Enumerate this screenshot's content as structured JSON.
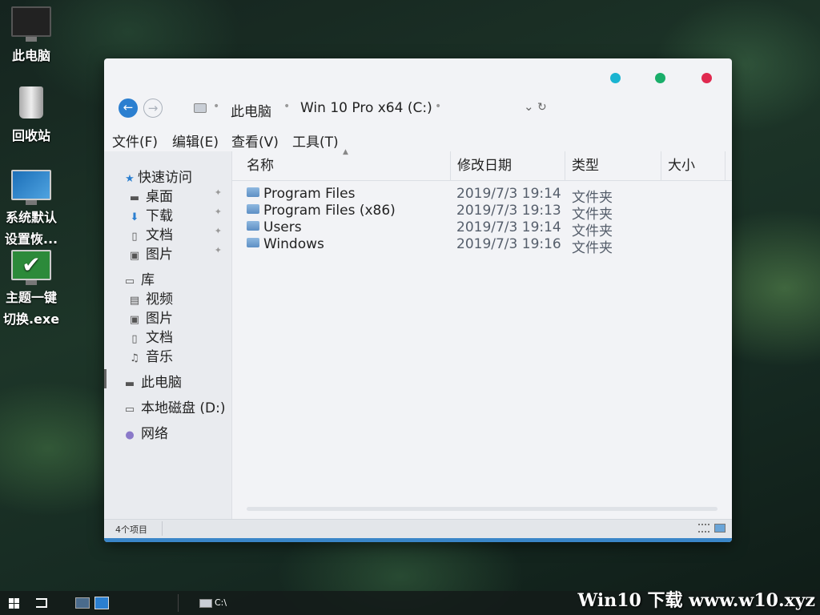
{
  "desktop": {
    "icons": [
      {
        "label": "此电脑"
      },
      {
        "label": "回收站"
      },
      {
        "label": "系统默认设置恢..."
      },
      {
        "label": "主题一键切换.exe"
      }
    ]
  },
  "window": {
    "controls_colors": [
      "#1ab4d1",
      "#1aae6a",
      "#e0294f"
    ],
    "address": {
      "back_label": "←",
      "forward_label": "→",
      "crumbs": [
        "此电脑",
        "Win 10 Pro x64 (C:)"
      ],
      "dropdown_label": "⌄",
      "refresh_label": "↻"
    },
    "menu": [
      "文件(F)",
      "编辑(E)",
      "查看(V)",
      "工具(T)"
    ],
    "sidebar": {
      "quick_access": "快速访问",
      "quick_items": [
        {
          "label": "桌面",
          "icon": "desktop-icon"
        },
        {
          "label": "下载",
          "icon": "download-icon"
        },
        {
          "label": "文档",
          "icon": "document-icon"
        },
        {
          "label": "图片",
          "icon": "picture-icon"
        }
      ],
      "library": "库",
      "library_items": [
        {
          "label": "视频",
          "icon": "video-icon"
        },
        {
          "label": "图片",
          "icon": "picture-icon"
        },
        {
          "label": "文档",
          "icon": "document-icon"
        },
        {
          "label": "音乐",
          "icon": "music-icon"
        }
      ],
      "this_pc": "此电脑",
      "local_disk": "本地磁盘 (D:)",
      "network": "网络"
    },
    "columns": [
      "名称",
      "修改日期",
      "类型",
      "大小"
    ],
    "files": [
      {
        "name": "Program Files",
        "date": "2019/7/3 19:14",
        "type": "文件夹"
      },
      {
        "name": "Program Files (x86)",
        "date": "2019/7/3 19:13",
        "type": "文件夹"
      },
      {
        "name": "Users",
        "date": "2019/7/3 19:14",
        "type": "文件夹"
      },
      {
        "name": "Windows",
        "date": "2019/7/3 19:16",
        "type": "文件夹"
      }
    ],
    "status": "4个项目"
  },
  "taskbar": {
    "drive_label": "C:\\",
    "watermark": "Win10 下载 www.w10.xyz"
  }
}
